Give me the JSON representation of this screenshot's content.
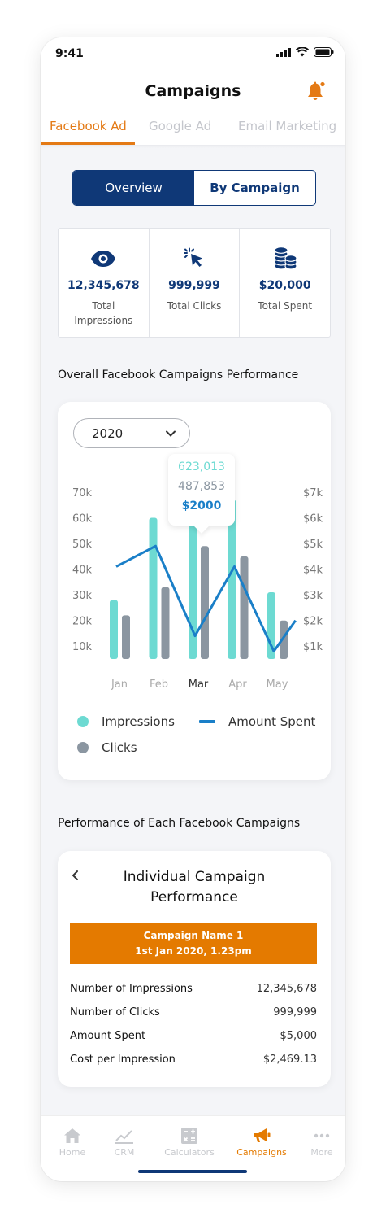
{
  "status": {
    "time": "9:41"
  },
  "header": {
    "title": "Campaigns"
  },
  "tabs": [
    {
      "label": "Facebook Ad",
      "active": true
    },
    {
      "label": "Google Ad",
      "active": false
    },
    {
      "label": "Email Marketing",
      "active": false
    }
  ],
  "segment": {
    "overview": "Overview",
    "by_campaign": "By Campaign"
  },
  "stats": [
    {
      "icon": "eye-icon",
      "value": "12,345,678",
      "label": "Total Impressions"
    },
    {
      "icon": "cursor-click-icon",
      "value": "999,999",
      "label": "Total Clicks"
    },
    {
      "icon": "coin-stack-icon",
      "value": "$20,000",
      "label": "Total Spent"
    }
  ],
  "overall_title": "Overall Facebook Campaigns Performance",
  "year_select": {
    "value": "2020"
  },
  "tooltip": {
    "impressions": "623,013",
    "clicks": "487,853",
    "spent": "$2000"
  },
  "legend": {
    "impressions": "Impressions",
    "amount_spent": "Amount Spent",
    "clicks": "Clicks"
  },
  "chart_data": {
    "type": "bar",
    "categories": [
      "Jan",
      "Feb",
      "Mar",
      "Apr",
      "May"
    ],
    "highlight_category": "Mar",
    "series": [
      {
        "name": "Impressions",
        "type": "bar",
        "axis": "left",
        "color": "#6ddad2",
        "values": [
          28000,
          60000,
          57000,
          67000,
          31000
        ]
      },
      {
        "name": "Clicks",
        "type": "bar",
        "axis": "left",
        "color": "#8b96a1",
        "values": [
          22000,
          33000,
          49000,
          45000,
          20000
        ]
      },
      {
        "name": "Amount Spent",
        "type": "line",
        "axis": "right",
        "color": "#1a7fc8",
        "x": [
          0,
          1,
          2,
          3,
          4,
          4.55
        ],
        "values": [
          4.1,
          4.9,
          1.4,
          4.1,
          0.8,
          2.0
        ]
      }
    ],
    "y_left": {
      "ticks": [
        "10k",
        "20k",
        "30k",
        "40k",
        "50k",
        "60k",
        "70k"
      ],
      "ylim": [
        5000,
        70000
      ]
    },
    "y_right": {
      "ticks": [
        "$1k",
        "$2k",
        "$3k",
        "$4k",
        "$5k",
        "$6k",
        "$7k"
      ],
      "ylim": [
        0.5,
        7
      ]
    },
    "grid": false
  },
  "campaigns_title": "Performance of Each Facebook Campaigns",
  "campaign_card": {
    "title": "Individual Campaign Performance",
    "name": "Campaign Name 1",
    "date": "1st Jan 2020, 1.23pm",
    "rows": [
      {
        "label": "Number of Impressions",
        "value": "12,345,678"
      },
      {
        "label": "Number of Clicks",
        "value": "999,999"
      },
      {
        "label": "Amount Spent",
        "value": "$5,000"
      },
      {
        "label": "Cost per Impression",
        "value": "$2,469.13"
      }
    ]
  },
  "nav": [
    {
      "label": "Home",
      "icon": "home-icon",
      "active": false
    },
    {
      "label": "CRM",
      "icon": "chart-line-icon",
      "active": false
    },
    {
      "label": "Calculators",
      "icon": "calculator-icon",
      "active": false
    },
    {
      "label": "Campaigns",
      "icon": "megaphone-icon",
      "active": true
    },
    {
      "label": "More",
      "icon": "more-dots-icon",
      "active": false
    }
  ],
  "colors": {
    "brand_navy": "#0f3877",
    "accent_orange": "#e47a15",
    "teal": "#6ddad2",
    "gray": "#8b96a1",
    "blue_line": "#1a7fc8"
  }
}
